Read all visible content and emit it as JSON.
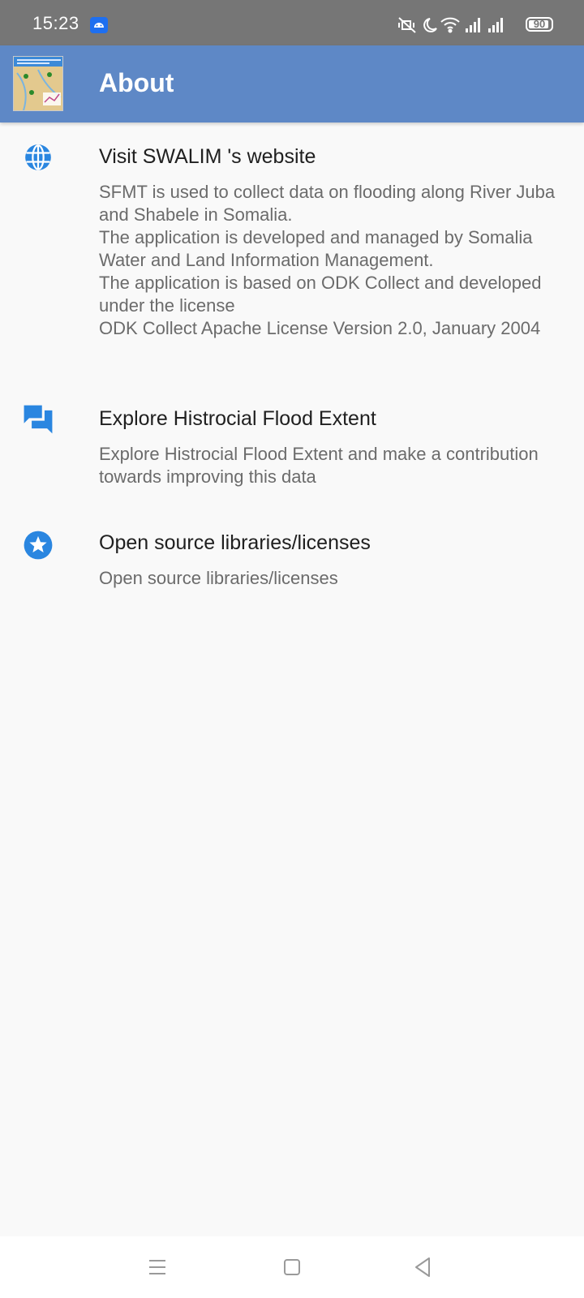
{
  "status_bar": {
    "time": "15:23",
    "battery": "90",
    "icons": [
      "android-icon",
      "mute-vibrate-icon",
      "moon-icon",
      "wifi-icon",
      "signal-icon",
      "signal-icon",
      "battery-icon"
    ]
  },
  "app_bar": {
    "title": "About",
    "background": "#5e88c6"
  },
  "items": [
    {
      "icon": "globe-icon",
      "title": "Visit SWALIM 's website",
      "description": "SFMT is used to collect data on flooding along River Juba and Shabele in Somalia.\nThe application is developed and managed by Somalia Water and Land Information Management.\nThe application is based on ODK Collect and developed under the license\nODK Collect Apache License Version 2.0, January 2004"
    },
    {
      "icon": "forum-icon",
      "title": "Explore Histrocial Flood Extent",
      "description": "Explore Histrocial Flood Extent and make a contribution towards improving this data"
    },
    {
      "icon": "star-badge-icon",
      "title": "Open source libraries/licenses",
      "description": "Open source libraries/licenses"
    }
  ],
  "accent_color": "#2a86e0",
  "nav_bar": {
    "buttons": [
      "menu-icon",
      "home-icon",
      "back-icon"
    ]
  }
}
